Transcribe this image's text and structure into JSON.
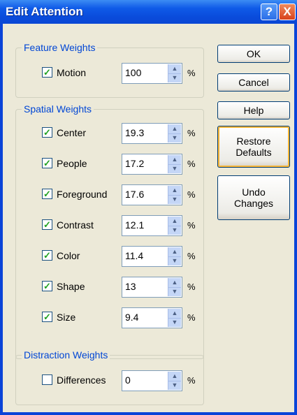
{
  "window": {
    "title": "Edit Attention",
    "help_label": "?",
    "close_label": "X"
  },
  "groups": {
    "feature_title": "Feature Weights",
    "spatial_title": "Spatial Weights",
    "distraction_title": "Distraction Weights"
  },
  "weights": {
    "motion": {
      "label": "Motion",
      "checked": true,
      "value": "100"
    },
    "center": {
      "label": "Center",
      "checked": true,
      "value": "19.3"
    },
    "people": {
      "label": "People",
      "checked": true,
      "value": "17.2"
    },
    "foreground": {
      "label": "Foreground",
      "checked": true,
      "value": "17.6"
    },
    "contrast": {
      "label": "Contrast",
      "checked": true,
      "value": "12.1"
    },
    "color": {
      "label": "Color",
      "checked": true,
      "value": "11.4"
    },
    "shape": {
      "label": "Shape",
      "checked": true,
      "value": "13"
    },
    "size": {
      "label": "Size",
      "checked": true,
      "value": "9.4"
    },
    "differences": {
      "label": "Differences",
      "checked": false,
      "value": "0"
    }
  },
  "units": {
    "percent": "%"
  },
  "buttons": {
    "ok": "OK",
    "cancel": "Cancel",
    "help": "Help",
    "restore_line1": "Restore",
    "restore_line2": "Defaults",
    "undo_line1": "Undo",
    "undo_line2": "Changes"
  },
  "glyphs": {
    "check": "✓",
    "spin_up": "▲",
    "spin_down": "▼"
  }
}
